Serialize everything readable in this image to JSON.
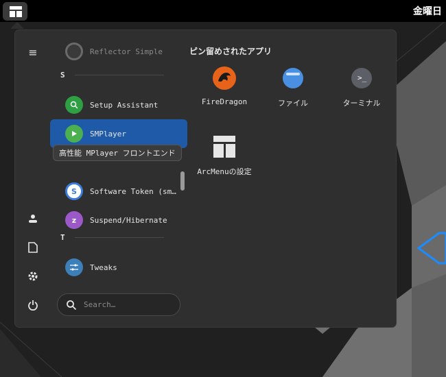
{
  "topbar": {
    "clock": "金曜日"
  },
  "list": {
    "items": [
      {
        "label": "Reflector Simple",
        "icon": "reflector-icon"
      },
      {
        "label": "Setup Assistant",
        "icon": "setup-assistant-icon"
      },
      {
        "label": "SMPlayer",
        "icon": "smplayer-icon"
      },
      {
        "label": "Software Token (sm…",
        "icon": "software-token-icon"
      },
      {
        "label": "Suspend/Hibernate",
        "icon": "suspend-icon"
      },
      {
        "label": "Tweaks",
        "icon": "tweaks-icon"
      }
    ],
    "sections": [
      "S",
      "T"
    ],
    "tooltip": "高性能 MPlayer フロントエンド"
  },
  "search": {
    "placeholder": "Search…"
  },
  "pinned": {
    "title": "ピン留めされたアプリ",
    "apps": [
      {
        "label": "FireDragon",
        "icon": "firedragon-icon"
      },
      {
        "label": "ファイル",
        "icon": "files-icon"
      },
      {
        "label": "ターミナル",
        "icon": "terminal-icon"
      },
      {
        "label": "ArcMenuの設定",
        "icon": "arcmenu-settings-icon"
      }
    ]
  },
  "colors": {
    "selected": "#1e5aa8",
    "panel": "#2f2f2f",
    "accent_blue": "#1a8cff"
  }
}
